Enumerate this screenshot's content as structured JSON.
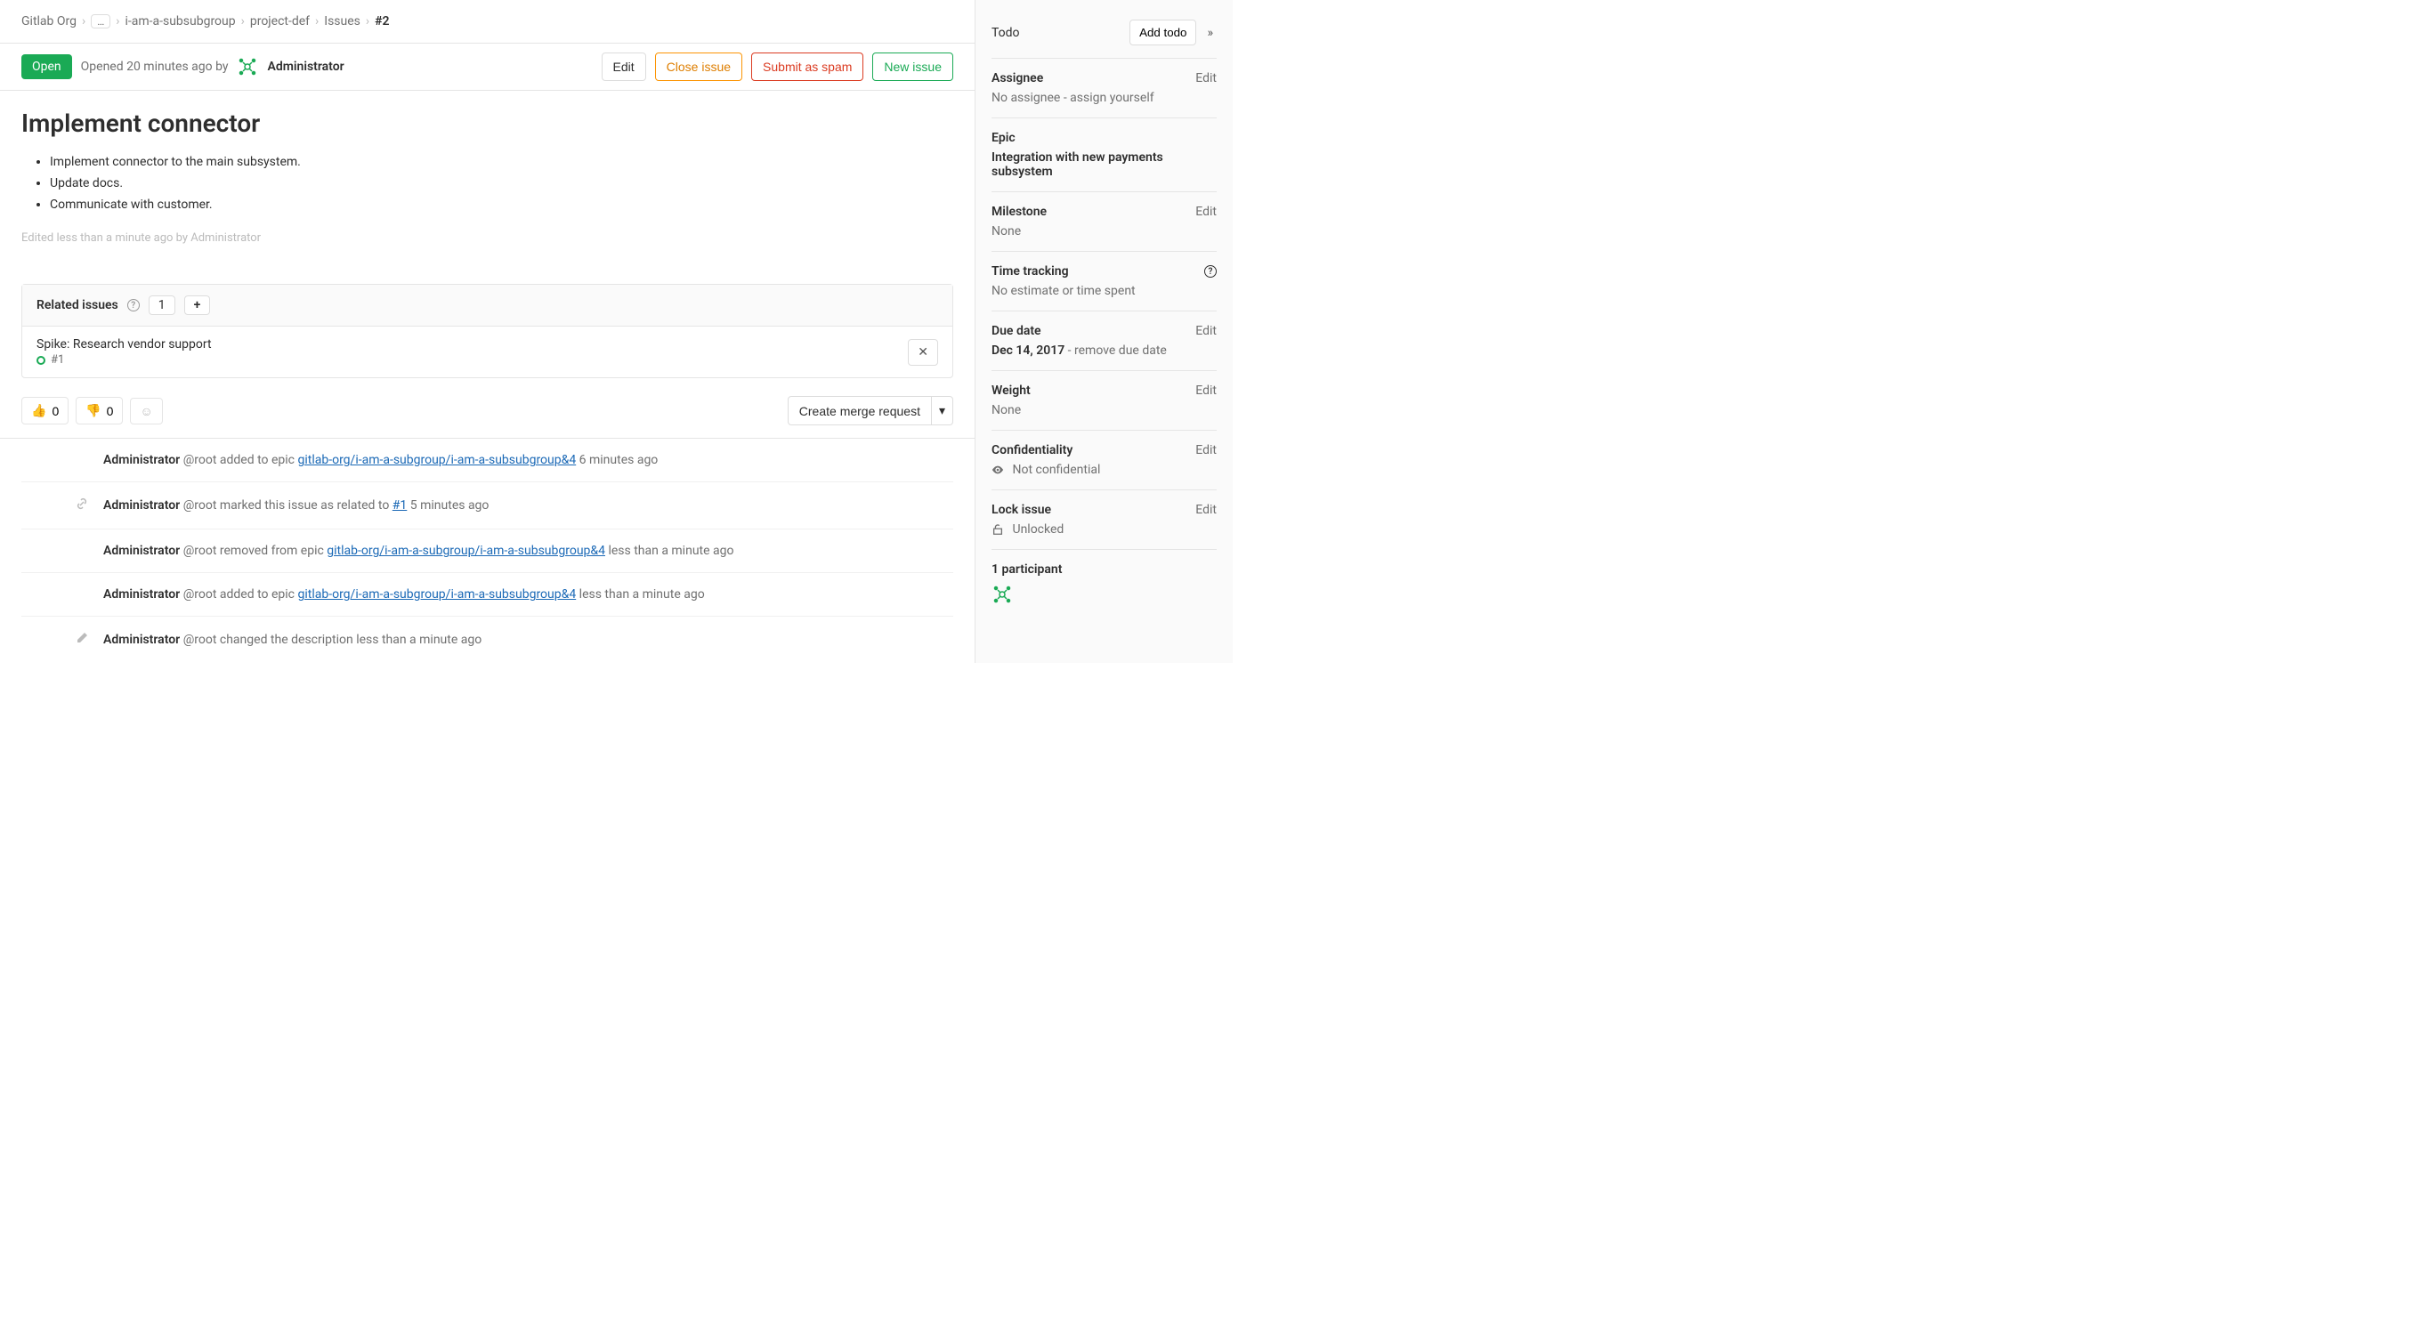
{
  "breadcrumb": {
    "org": "Gitlab Org",
    "subgroup": "i-am-a-subsubgroup",
    "project": "project-def",
    "section": "Issues",
    "current": "#2"
  },
  "status": {
    "badge": "Open",
    "opened_text": "Opened 20 minutes ago by",
    "author": "Administrator"
  },
  "actions": {
    "edit": "Edit",
    "close": "Close issue",
    "spam": "Submit as spam",
    "new": "New issue"
  },
  "issue": {
    "title": "Implement connector",
    "desc_items": [
      "Implement connector to the main subsystem.",
      "Update docs.",
      "Communicate with customer."
    ],
    "edited_note": "Edited less than a minute ago by Administrator"
  },
  "related": {
    "header": "Related issues",
    "count": "1",
    "item_title": "Spike: Research vendor support",
    "item_ref": "#1"
  },
  "reactions": {
    "thumbs_up": "0",
    "thumbs_down": "0"
  },
  "mr_button": "Create merge request",
  "activity": [
    {
      "user": "Administrator",
      "handle": "@root",
      "action": " added to epic ",
      "link": "gitlab-org/i-am-a-subgroup/i-am-a-subsubgroup&4",
      "time": " 6 minutes ago",
      "icon": ""
    },
    {
      "user": "Administrator",
      "handle": "@root",
      "action": " marked this issue as related to ",
      "link": "#1",
      "time": " 5 minutes ago",
      "icon": "link"
    },
    {
      "user": "Administrator",
      "handle": "@root",
      "action": " removed from epic ",
      "link": "gitlab-org/i-am-a-subgroup/i-am-a-subsubgroup&4",
      "time": " less than a minute ago",
      "icon": ""
    },
    {
      "user": "Administrator",
      "handle": "@root",
      "action": " added to epic ",
      "link": "gitlab-org/i-am-a-subgroup/i-am-a-subsubgroup&4",
      "time": " less than a minute ago",
      "icon": ""
    },
    {
      "user": "Administrator",
      "handle": "@root",
      "action": " changed the description ",
      "link": "",
      "time": "less than a minute ago",
      "icon": "pencil"
    }
  ],
  "sidebar": {
    "todo_label": "Todo",
    "add_todo": "Add todo",
    "assignee_label": "Assignee",
    "assignee_edit": "Edit",
    "assignee_value": "No assignee - assign yourself",
    "epic_label": "Epic",
    "epic_value": "Integration with new payments subsystem",
    "milestone_label": "Milestone",
    "milestone_edit": "Edit",
    "milestone_value": "None",
    "time_label": "Time tracking",
    "time_value": "No estimate or time spent",
    "due_label": "Due date",
    "due_edit": "Edit",
    "due_value": "Dec 14, 2017",
    "due_remove": " - remove due date",
    "weight_label": "Weight",
    "weight_edit": "Edit",
    "weight_value": "None",
    "conf_label": "Confidentiality",
    "conf_edit": "Edit",
    "conf_value": "Not confidential",
    "lock_label": "Lock issue",
    "lock_edit": "Edit",
    "lock_value": "Unlocked",
    "participants": "1 participant"
  }
}
